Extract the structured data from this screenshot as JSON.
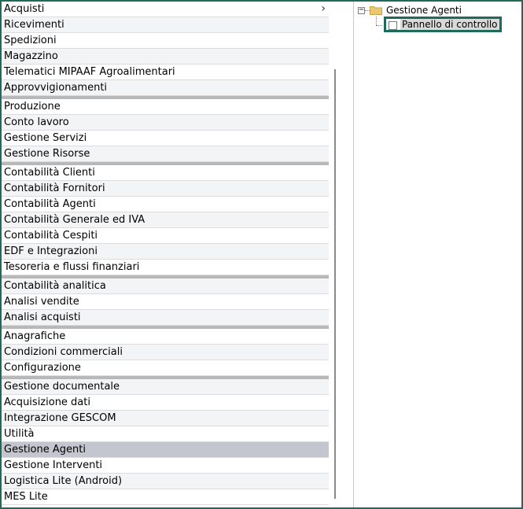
{
  "menu": {
    "items": [
      {
        "label": "Acquisti",
        "has_submenu": true
      },
      {
        "label": "Ricevimenti"
      },
      {
        "label": "Spedizioni"
      },
      {
        "label": "Magazzino"
      },
      {
        "label": "Telematici MIPAAF Agroalimentari"
      },
      {
        "label": "Approvvigionamenti"
      },
      {
        "separator": true
      },
      {
        "label": "Produzione"
      },
      {
        "label": "Conto lavoro"
      },
      {
        "label": "Gestione Servizi"
      },
      {
        "label": "Gestione Risorse"
      },
      {
        "separator": true
      },
      {
        "label": "Contabilità Clienti"
      },
      {
        "label": "Contabilità Fornitori"
      },
      {
        "label": "Contabilità Agenti"
      },
      {
        "label": "Contabilità Generale ed IVA"
      },
      {
        "label": "Contabilità Cespiti"
      },
      {
        "label": "EDF e Integrazioni"
      },
      {
        "label": "Tesoreria e flussi finanziari"
      },
      {
        "separator": true
      },
      {
        "label": "Contabilità analitica"
      },
      {
        "label": "Analisi vendite"
      },
      {
        "label": "Analisi acquisti"
      },
      {
        "separator": true
      },
      {
        "label": "Anagrafiche"
      },
      {
        "label": "Condizioni commerciali"
      },
      {
        "label": "Configurazione"
      },
      {
        "separator": true
      },
      {
        "label": "Gestione documentale"
      },
      {
        "label": "Acquisizione dati"
      },
      {
        "label": "Integrazione GESCOM"
      },
      {
        "label": "Utilità"
      },
      {
        "label": "Gestione Agenti",
        "selected": true
      },
      {
        "label": "Gestione Interventi"
      },
      {
        "label": "Logistica Lite (Android)"
      },
      {
        "label": "MES Lite"
      }
    ],
    "chevron": "›"
  },
  "tree": {
    "expander": "−",
    "root_label": "Gestione Agenti",
    "child_label": "Pannello di controllo",
    "icons": {
      "root": "folder-icon",
      "child": "document-icon"
    }
  },
  "colors": {
    "accent_border": "#1e6b5c",
    "selected_row": "#c3c5cf",
    "folder": "#e8c873"
  }
}
